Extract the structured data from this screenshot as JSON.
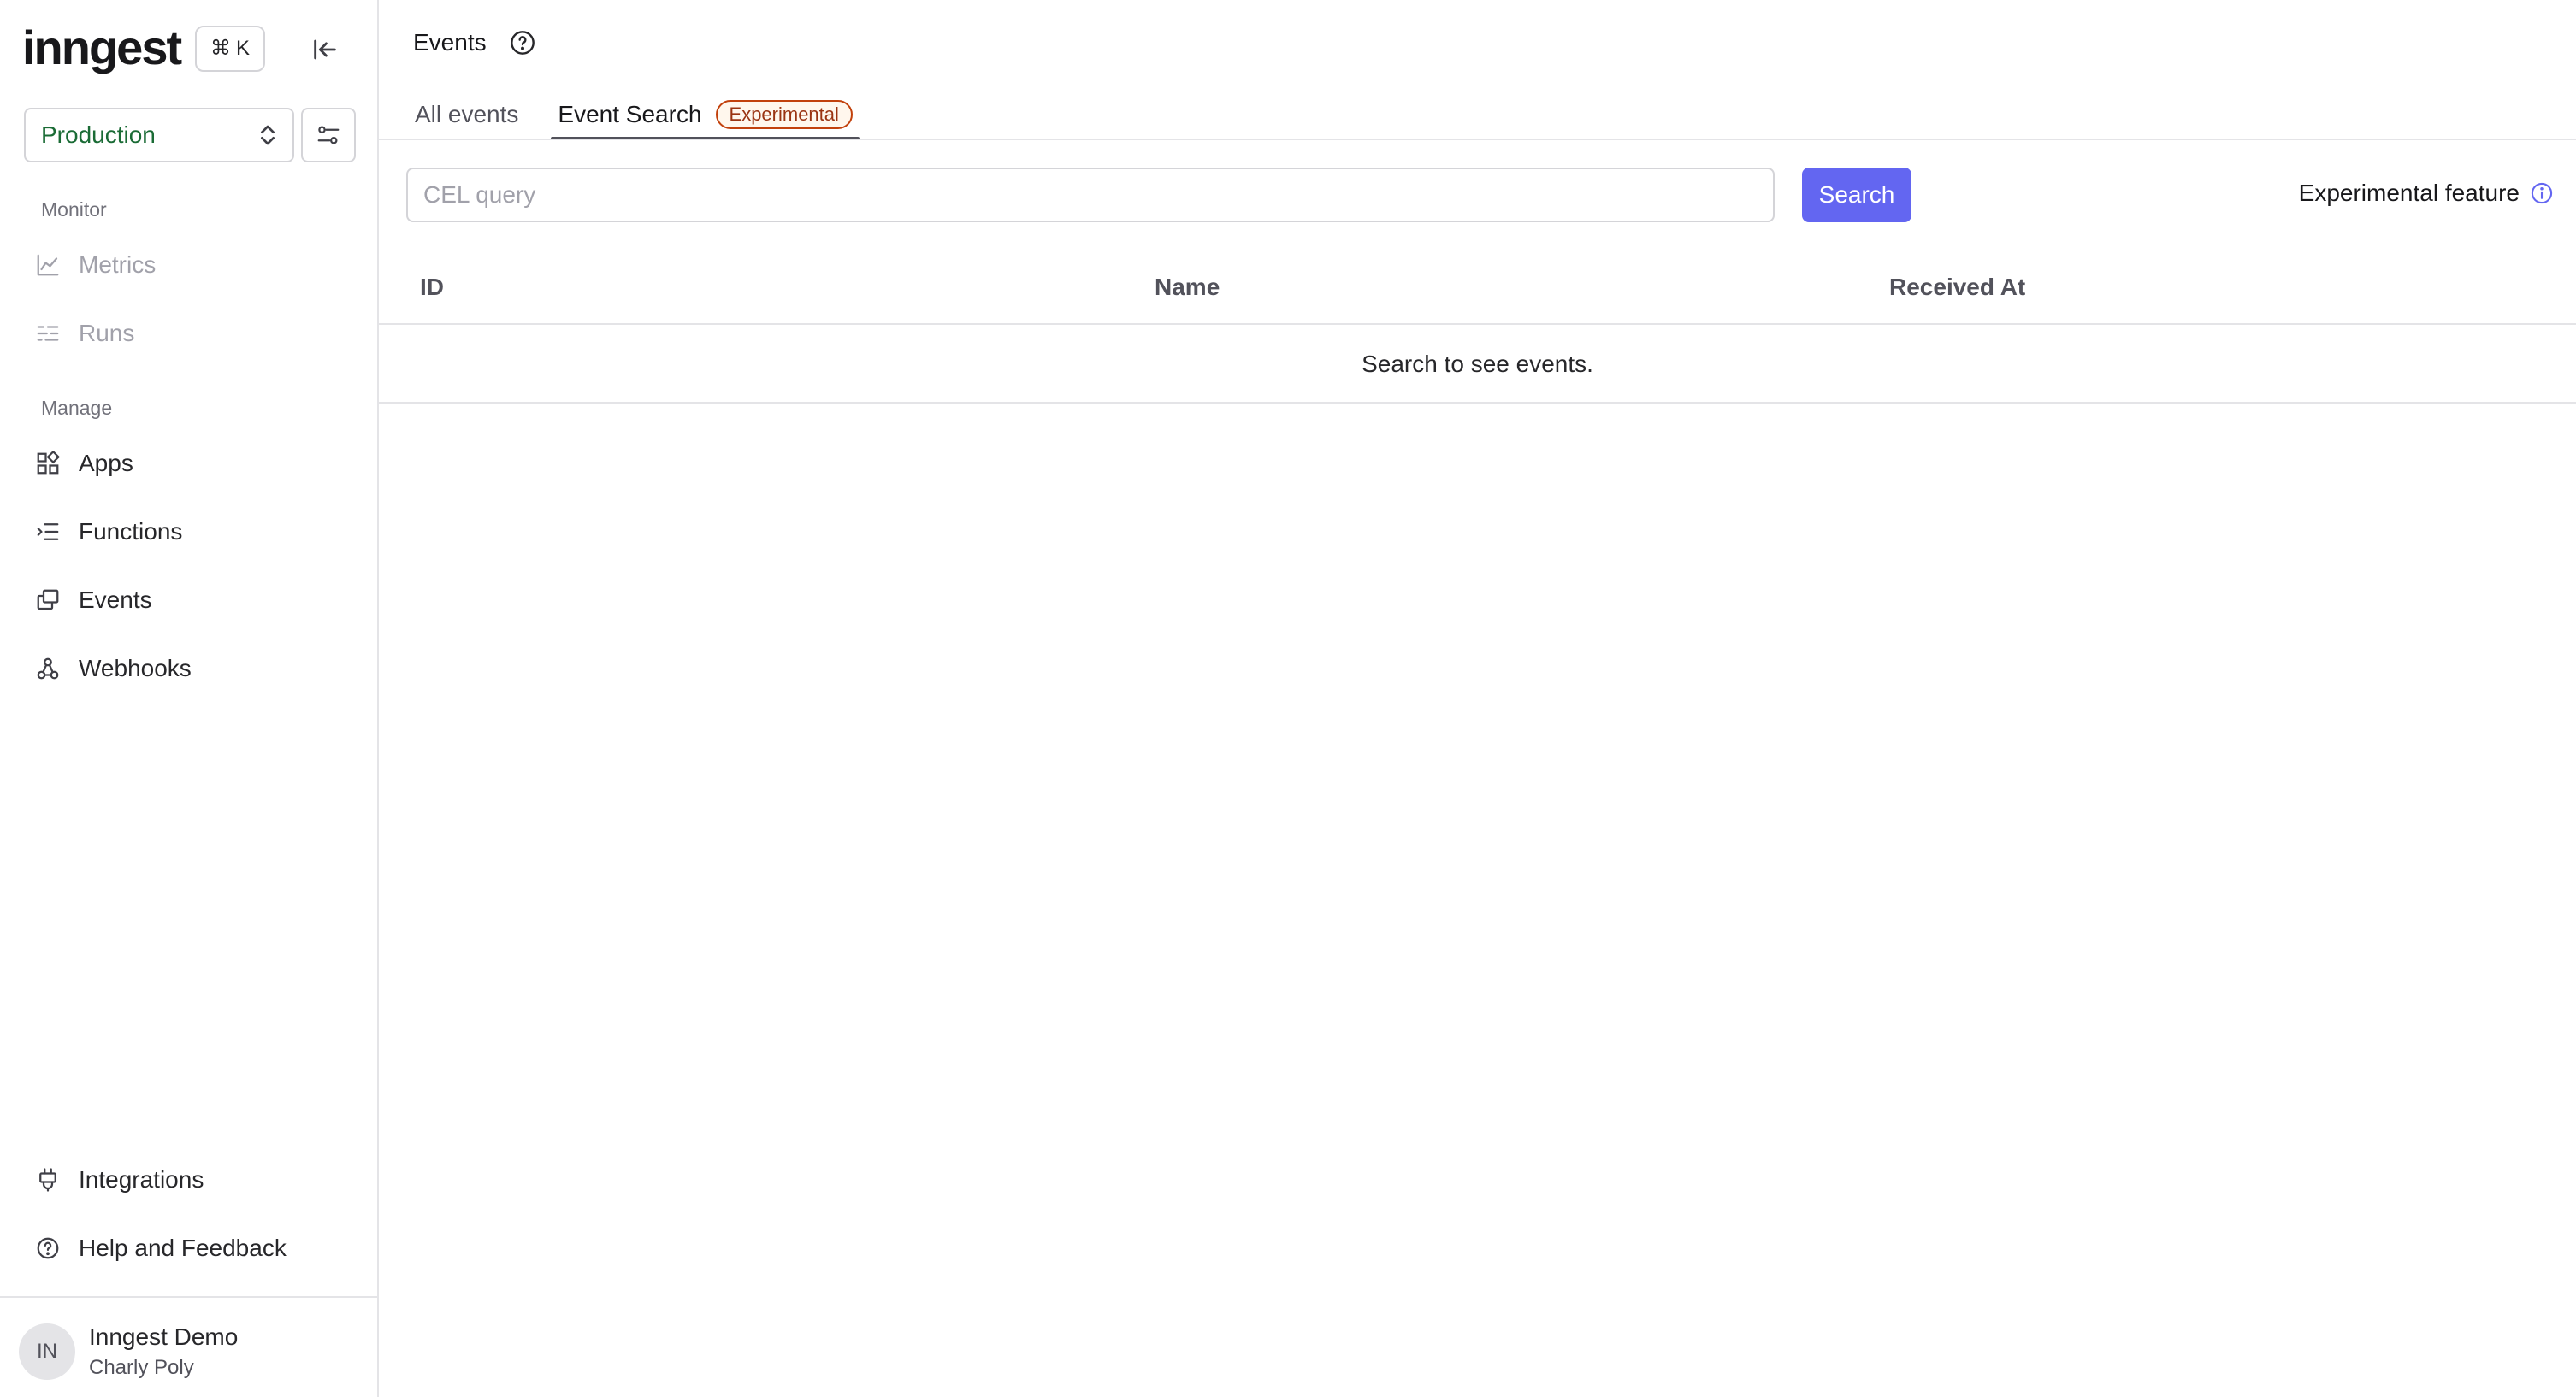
{
  "sidebar": {
    "logo": "inngest",
    "shortcut": {
      "symbol": "⌘",
      "key": "K"
    },
    "environment": "Production",
    "sections": {
      "monitor": {
        "label": "Monitor",
        "items": [
          {
            "label": "Metrics",
            "icon": "chart-line-icon",
            "enabled": false
          },
          {
            "label": "Runs",
            "icon": "runs-list-icon",
            "enabled": false
          }
        ]
      },
      "manage": {
        "label": "Manage",
        "items": [
          {
            "label": "Apps",
            "icon": "apps-grid-icon"
          },
          {
            "label": "Functions",
            "icon": "functions-list-icon"
          },
          {
            "label": "Events",
            "icon": "events-window-icon"
          },
          {
            "label": "Webhooks",
            "icon": "webhook-icon"
          }
        ]
      }
    },
    "footer_items": [
      {
        "label": "Integrations",
        "icon": "plug-icon"
      },
      {
        "label": "Help and Feedback",
        "icon": "help-circle-icon"
      }
    ],
    "account": {
      "initials": "IN",
      "org": "Inngest Demo",
      "user": "Charly Poly"
    }
  },
  "main": {
    "title": "Events",
    "tabs": [
      {
        "label": "All events",
        "active": false
      },
      {
        "label": "Event Search",
        "active": true,
        "badge": "Experimental"
      }
    ],
    "search": {
      "placeholder": "CEL query",
      "value": "",
      "button": "Search"
    },
    "experimental_note": "Experimental feature",
    "table": {
      "columns": [
        "ID",
        "Name",
        "Received At"
      ],
      "empty_message": "Search to see events."
    }
  },
  "colors": {
    "accent": "#6366f1",
    "environment": "#1a6b35",
    "badge": "#c2410c"
  }
}
